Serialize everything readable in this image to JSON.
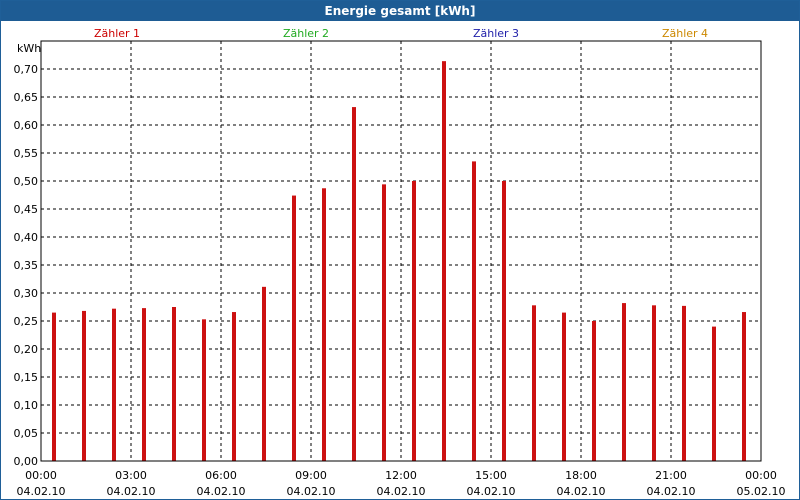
{
  "window": {
    "title": "Energie gesamt [kWh]"
  },
  "legend": [
    {
      "label": "Zähler 1",
      "color": "#cc0000"
    },
    {
      "label": "Zähler 2",
      "color": "#22aa22"
    },
    {
      "label": "Zähler 3",
      "color": "#2222aa"
    },
    {
      "label": "Zähler 4",
      "color": "#cc8800"
    }
  ],
  "chart_data": {
    "type": "bar",
    "title": "Energie gesamt [kWh]",
    "ylabel": "kWh",
    "xlabel": "",
    "ylim": [
      0,
      0.75
    ],
    "yticks": [
      "0,00",
      "0,05",
      "0,10",
      "0,15",
      "0,20",
      "0,25",
      "0,30",
      "0,35",
      "0,40",
      "0,45",
      "0,50",
      "0,55",
      "0,60",
      "0,65",
      "0,70"
    ],
    "xticks": [
      {
        "time": "00:00",
        "date": "04.02.10"
      },
      {
        "time": "03:00",
        "date": "04.02.10"
      },
      {
        "time": "06:00",
        "date": "04.02.10"
      },
      {
        "time": "09:00",
        "date": "04.02.10"
      },
      {
        "time": "12:00",
        "date": "04.02.10"
      },
      {
        "time": "15:00",
        "date": "04.02.10"
      },
      {
        "time": "18:00",
        "date": "04.02.10"
      },
      {
        "time": "21:00",
        "date": "04.02.10"
      },
      {
        "time": "00:00",
        "date": "05.02.10"
      }
    ],
    "grid": true,
    "bar_color": "#cc1111",
    "series": [
      {
        "name": "Zähler 1",
        "hours": [
          0,
          1,
          2,
          3,
          4,
          5,
          6,
          7,
          8,
          9,
          10,
          11,
          12,
          13,
          14,
          15,
          16,
          17,
          18,
          19,
          20,
          21,
          22,
          23
        ],
        "values": [
          0.265,
          0.268,
          0.272,
          0.273,
          0.275,
          0.253,
          0.266,
          0.311,
          0.474,
          0.487,
          0.632,
          0.494,
          0.5,
          0.714,
          0.535,
          0.5,
          0.278,
          0.265,
          0.25,
          0.282,
          0.278,
          0.277,
          0.24,
          0.266
        ]
      }
    ]
  }
}
